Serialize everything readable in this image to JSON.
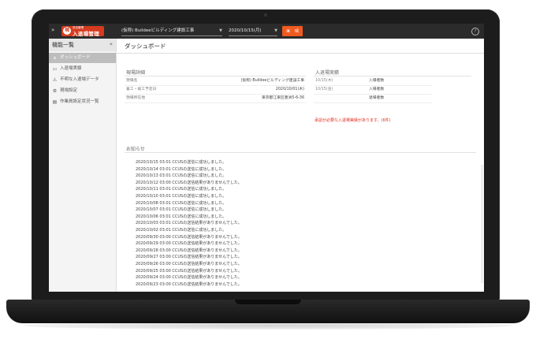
{
  "header": {
    "menu_icon": "»",
    "logo_sub": "安全管理",
    "logo_main": "入退場管理",
    "logo_mark": "現",
    "site_select": "(仮称) Buildeeビルディング建設工事",
    "date_select": "2020/10/15(月)",
    "weather_label": "晴",
    "help": "?"
  },
  "sidebar": {
    "title": "機能一覧",
    "collapse": "«",
    "items": [
      {
        "label": "ダッシュボード",
        "icon": "home-icon",
        "glyph": "⌂",
        "active": true
      },
      {
        "label": "入退場実績",
        "icon": "calendar-icon",
        "glyph": "▭",
        "active": false
      },
      {
        "label": "不明な入退場データ",
        "icon": "warning-icon",
        "glyph": "⚠",
        "active": false
      },
      {
        "label": "現場設定",
        "icon": "gear-icon",
        "glyph": "⚙",
        "active": false
      },
      {
        "label": "作業員設定状況一覧",
        "icon": "list-icon",
        "glyph": "▤",
        "active": false
      }
    ]
  },
  "main": {
    "title": "ダッシュボード",
    "site_details": {
      "heading": "現場詳細",
      "rows": [
        {
          "label": "現場名",
          "value": "(仮称) Buildeeビルディング建設工事"
        },
        {
          "label": "着工・竣工予定日",
          "value": "2020/10/01(木)"
        },
        {
          "label": "現場所在地",
          "value": "東京都江東区豊洲5-6-36"
        }
      ]
    },
    "attendance": {
      "heading": "入退場実績",
      "rows": [
        {
          "date": "10/15(木)",
          "label": "入場者数"
        },
        {
          "date": "10/15(金)",
          "label": "入場者数"
        },
        {
          "date": "",
          "label": "退場者数"
        }
      ],
      "warning": "承認が必要な入退場実績があります。(6件)"
    },
    "notices": {
      "heading": "お知らせ",
      "items": [
        "2020/10/15 03:01 CCUSの送信に成功しました。",
        "2020/10/14 03:01 CCUSの送信に成功しました。",
        "2020/10/13 03:01 CCUSの送信に成功しました。",
        "2020/10/12 03:00 CCUSの送信結果がありませんでした。",
        "2020/10/11 03:01 CCUSの送信に成功しました。",
        "2020/10/10 03:01 CCUSの送信に成功しました。",
        "2020/10/08 03:01 CCUSの送信に成功しました。",
        "2020/10/07 03:01 CCUSの送信に成功しました。",
        "2020/10/06 03:01 CCUSの送信に成功しました。",
        "2020/10/03 03:01 CCUSの送信結果がありませんでした。",
        "2020/10/02 03:01 CCUSの送信に成功しました。",
        "2020/09/30 03:00 CCUSの送信結果がありませんでした。",
        "2020/09/29 03:00 CCUSの送信結果がありませんでした。",
        "2020/09/28 03:00 CCUSの送信結果がありませんでした。",
        "2020/09/27 03:00 CCUSの送信結果がありませんでした。",
        "2020/09/26 03:00 CCUSの送信結果がありませんでした。",
        "2020/09/25 03:00 CCUSの送信結果がありませんでした。",
        "2020/09/24 03:00 CCUSの送信結果がありませんでした。",
        "2020/09/23 03:00 CCUSの送信結果がありませんでした。"
      ]
    }
  }
}
